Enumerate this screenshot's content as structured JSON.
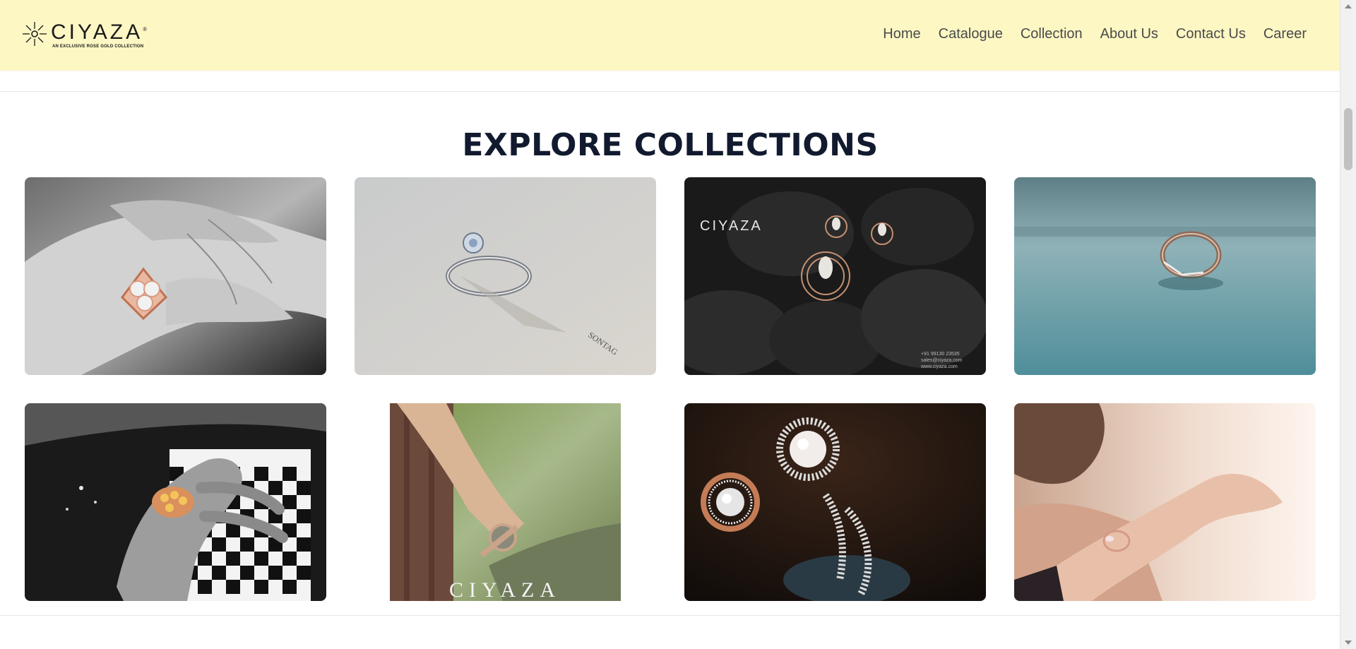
{
  "header": {
    "logo": {
      "word": "CIYAZA",
      "registered": "®",
      "tagline": "AN EXCLUSIVE ROSE GOLD COLLECTION"
    },
    "nav": [
      {
        "label": "Home"
      },
      {
        "label": "Catalogue"
      },
      {
        "label": "Collection"
      },
      {
        "label": "About Us"
      },
      {
        "label": "Contact Us"
      },
      {
        "label": "Career"
      }
    ]
  },
  "section": {
    "title": "EXPLORE COLLECTIONS"
  },
  "collections": [
    {
      "subject": "rose-gold-ring-on-hand"
    },
    {
      "subject": "solitaire-ring-on-paper"
    },
    {
      "subject": "earrings-and-pendant-on-black-stones"
    },
    {
      "subject": "ring-on-teal-surface"
    },
    {
      "subject": "ring-hand-holding-checkered-mug"
    },
    {
      "subject": "watch-on-wrist"
    },
    {
      "subject": "pearl-and-diamond-rings"
    },
    {
      "subject": "bracelet-on-wrist"
    }
  ],
  "image_text": {
    "card3_logo": "CIYAZA",
    "card3_contact": [
      "+91 99130 23535",
      "sales@ciyaza.com",
      "www.ciyaza.com"
    ],
    "card6_logo": "CIYAZA"
  },
  "colors": {
    "header_bg": "#fdf7c4",
    "title": "#111a2e",
    "nav_text": "#4a4a4a"
  }
}
